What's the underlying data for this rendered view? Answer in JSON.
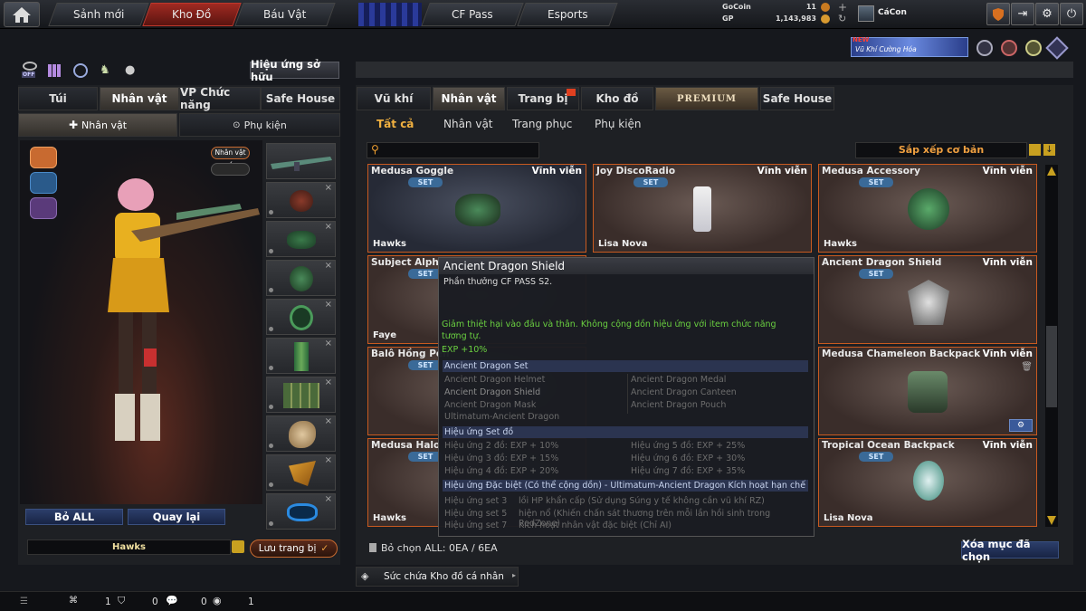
{
  "nav": {
    "tabs": [
      "Sảnh mới",
      "Kho Đồ",
      "Báu Vật",
      "CF Pass",
      "Esports"
    ],
    "active_index": 1
  },
  "currency": {
    "gocoin_label": "GoCoin",
    "gocoin_value": "11",
    "gp_label": "GP",
    "gp_value": "1,143,983"
  },
  "user": {
    "name": "CáCon"
  },
  "banner": {
    "badge": "NEW",
    "text": "Vũ Khí Cường Hóa"
  },
  "left": {
    "effect_button": "Hiệu ứng sở hữu",
    "off_label": "OFF",
    "tabs": [
      "Túi",
      "Nhân vật",
      "VP Chức năng",
      "Safe House"
    ],
    "subtabs": [
      "Nhân vật",
      "Phụ kiện"
    ],
    "char_tag": "Nhân vật ✓",
    "remove_all": "Bỏ ALL",
    "back": "Quay lại",
    "char_name": "Hawks",
    "save": "Lưu trang bị"
  },
  "right": {
    "tabs": [
      "Vũ khí",
      "Nhân vật",
      "Trang bị",
      "Kho đồ",
      "PREMIUM",
      "Safe House"
    ],
    "subtabs": [
      "Tất cả",
      "Nhân vật",
      "Trang phục",
      "Phụ kiện"
    ],
    "sort": "Sắp xếp cơ bản",
    "select_status": "Bỏ chọn ALL: 0EA / 6EA",
    "delete_selected": "Xóa mục đã chọn",
    "storage": "Sức chứa Kho đồ cá nhân"
  },
  "items": [
    {
      "name": "Medusa Goggle",
      "perm": "Vĩnh viễn",
      "set": "SET",
      "owner": "Hawks"
    },
    {
      "name": "Joy DiscoRadio",
      "perm": "Vĩnh viễn",
      "set": "SET",
      "owner": "Lisa Nova"
    },
    {
      "name": "Medusa Accessory",
      "perm": "Vĩnh viễn",
      "set": "SET",
      "owner": "Hawks"
    },
    {
      "name": "Subject Alpha",
      "perm": "",
      "set": "SET",
      "owner": "Faye"
    },
    {
      "name": "Ancient Dragon Shield",
      "perm": "Vĩnh viễn",
      "set": "SET",
      "owner": ""
    },
    {
      "name": "Balô Hồng Pen",
      "perm": "",
      "set": "SET",
      "owner": ""
    },
    {
      "name": "Medusa Chameleon Backpack",
      "perm": "Vĩnh viễn",
      "set": "",
      "owner": ""
    },
    {
      "name": "Medusa Halo",
      "perm": "",
      "set": "SET",
      "owner": "Hawks"
    },
    {
      "name": "Tropical Ocean Backpack",
      "perm": "Vĩnh viễn",
      "set": "SET",
      "owner": "Lisa Nova"
    }
  ],
  "tooltip": {
    "title": "Ancient Dragon Shield",
    "subtitle": "Phần thưởng CF PASS S2.",
    "desc": "Giảm thiệt hại vào đầu và thân. Không cộng dồn hiệu ứng với item chức năng tương tự.",
    "exp": "EXP +10%",
    "set_header": "Ancient Dragon Set",
    "set_items": [
      "Ancient Dragon Helmet",
      "Ancient Dragon Medal",
      "Ancient Dragon Shield",
      "Ancient Dragon Canteen",
      "Ancient Dragon Mask",
      "Ancient Dragon Pouch",
      "Ultimatum-Ancient Dragon"
    ],
    "effect_header": "Hiệu ứng Set đồ",
    "effects": [
      "Hiệu ứng 2 đồ: EXP + 10%",
      "Hiệu ứng 5 đồ: EXP + 25%",
      "Hiệu ứng 3 đồ: EXP + 15%",
      "Hiệu ứng 6 đồ: EXP + 30%",
      "Hiệu ứng 4 đồ: EXP + 20%",
      "Hiệu ứng 7 đồ: EXP + 35%"
    ],
    "special_header": "Hiệu ứng Đặc biệt (Có thể cộng dồn) - Ultimatum-Ancient Dragon Kích hoạt hạn chế",
    "special": [
      {
        "k": "Hiệu ứng set 3",
        "v": "lồi HP khẩn cấp (Sử dụng Súng y tế không cần vũ khí RZ)"
      },
      {
        "k": "Hiệu ứng set 5",
        "v": "hiện nổ (Khiến chấn sát thương trên mỗi lần hồi sinh trong RedZone)"
      },
      {
        "k": "Hiệu ứng set 7",
        "v": "Kích hoạt nhân vật đặc biệt (Chỉ AI)"
      }
    ]
  },
  "bottom": {
    "c1": "1",
    "c2": "0",
    "c3": "0",
    "c4": "1"
  }
}
